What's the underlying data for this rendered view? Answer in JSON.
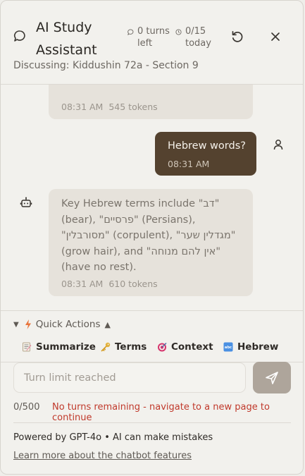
{
  "header": {
    "title": "AI Study Assistant",
    "subtitle": "Discussing: Kiddushin 72a - Section 9",
    "turns_left": "0 turns left",
    "daily": "0/15 today",
    "icons": {
      "chat": "chat-bubble-icon",
      "turns": "chat-small-icon",
      "clock": "clock-icon",
      "reset": "reset-icon",
      "close": "close-icon"
    }
  },
  "messages": {
    "previous": {
      "time": "08:31 AM",
      "tokens": "545 tokens"
    },
    "user": {
      "text": "Hebrew words?",
      "time": "08:31 AM"
    },
    "assistant": {
      "text": "Key Hebrew terms include \"דב\" (bear), \"פרסיים\" (Persians), \"מסורבלין\" (corpulent), \"מגדלין שער\" (grow hair), and \"אין להם מנוחה\" (have no rest).",
      "time": "08:31 AM",
      "tokens": "610 tokens"
    }
  },
  "quick_actions": {
    "label": "Quick Actions",
    "buttons": [
      "Summarize",
      "Terms",
      "Context",
      "Hebrew"
    ]
  },
  "input": {
    "placeholder": "Turn limit reached",
    "counter": "0/500",
    "warning": "No turns remaining - navigate to a new page to continue"
  },
  "footer": {
    "powered": "Powered by GPT-4o • AI can make mistakes",
    "learn_more": "Learn more about the chatbot features"
  },
  "colors": {
    "accent": "#54422f",
    "warning": "#c0392b",
    "send_disabled": "#aea59b"
  }
}
